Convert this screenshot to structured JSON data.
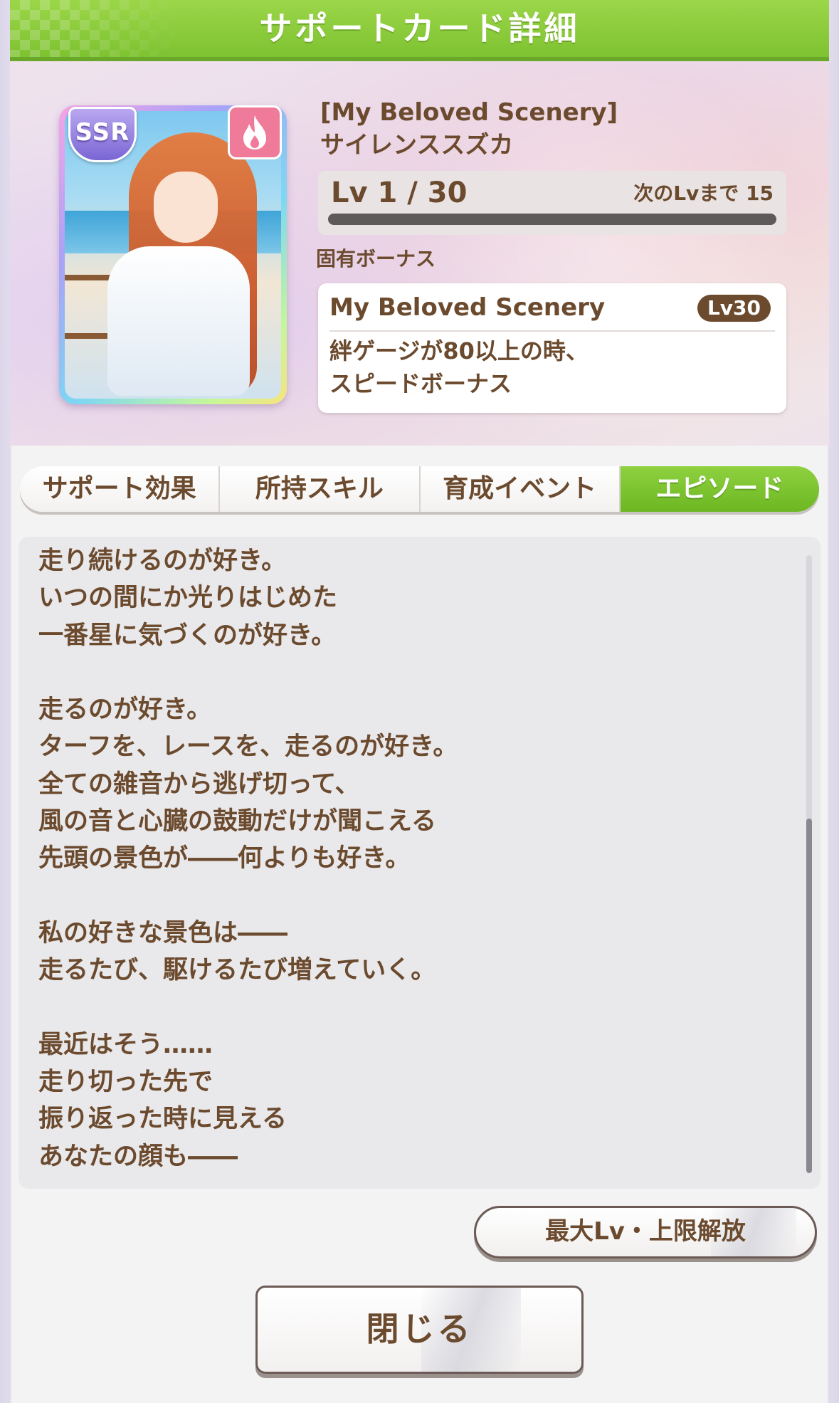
{
  "header": {
    "title": "サポートカード詳細"
  },
  "card": {
    "rarity": "SSR",
    "type_icon": "fire-icon",
    "title": "[My Beloved Scenery]",
    "name": "サイレンススズカ"
  },
  "level": {
    "text": "Lv 1 / 30",
    "next": "次のLvまで 15",
    "progress": 0
  },
  "unique_bonus": {
    "label": "固有ボーナス",
    "name": "My Beloved Scenery",
    "lv": "Lv30",
    "description": "絆ゲージが80以上の時、\nスピードボーナス"
  },
  "tabs": [
    {
      "label": "サポート効果",
      "active": false
    },
    {
      "label": "所持スキル",
      "active": false
    },
    {
      "label": "育成イベント",
      "active": false
    },
    {
      "label": "エピソード",
      "active": true
    }
  ],
  "episode": {
    "text": "走り続けるのが好き。\nいつの間にか光りはじめた\n一番星に気づくのが好き。\n\n走るのが好き。\nターフを、レースを、走るのが好き。\n全ての雑音から逃げ切って、\n風の音と心臓の鼓動だけが聞こえる\n先頭の景色が――何よりも好き。\n\n私の好きな景色は――\n走るたび、駆けるたび増えていく。\n\n最近はそう……\n走り切った先で\n振り返った時に見える\nあなたの顔も――"
  },
  "buttons": {
    "max_lv": "最大Lv・上限解放",
    "close": "閉じる"
  },
  "colors": {
    "accent_green": "#7cc12f",
    "text_brown": "#6b4a2e",
    "fire_badge": "#f07a9a"
  }
}
